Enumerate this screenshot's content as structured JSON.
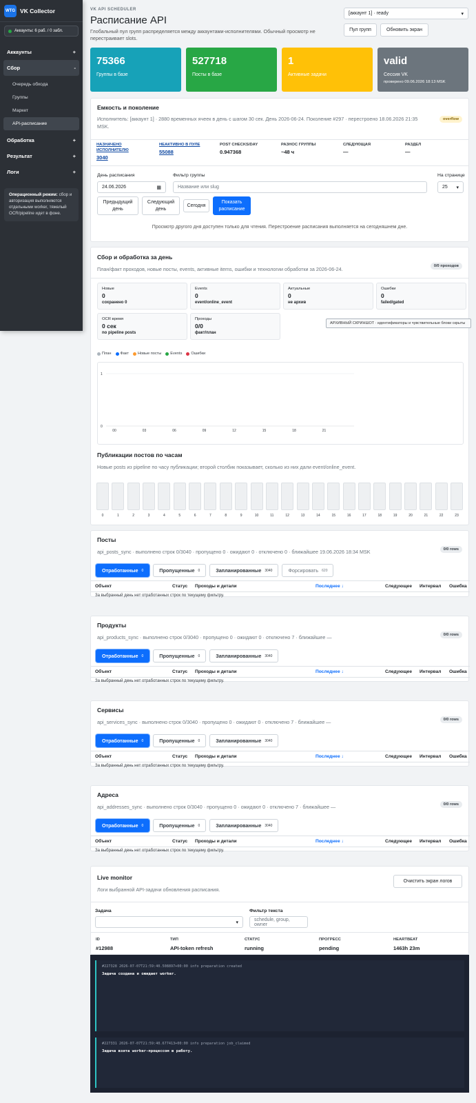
{
  "sidebar": {
    "brand_logo": "WTG",
    "brand_name": "VK Collector",
    "accounts_badge": "Аккаунты: 6 раб. / 0 забл.",
    "sections": [
      {
        "label": "Аккаунты",
        "toggle": "+"
      },
      {
        "label": "Сбор",
        "toggle": "-"
      },
      {
        "label": "Обработка",
        "toggle": "+"
      },
      {
        "label": "Результат",
        "toggle": "+"
      },
      {
        "label": "Логи",
        "toggle": "+"
      }
    ],
    "sbor_items": [
      "Очередь обхода",
      "Группы",
      "Маркет",
      "API-расписание"
    ],
    "op_note_bold": "Операционный режим:",
    "op_note_text": " сбор и авторизация выполняются отдельными worker, тяжелый OCR/pipeline идет в фоне."
  },
  "header": {
    "kicker": "VK API SCHEDULER",
    "title": "Расписание API",
    "subtitle": "Глобальный пул групп распределяется между аккаунтами-исполнителями. Обычный просмотр не перестраивает slots.",
    "account_select": "[аккаунт 1] · ready",
    "pool_button": "Пул групп",
    "refresh_button": "Обновить экран"
  },
  "stats": [
    {
      "value": "75366",
      "label": "Группы в базе",
      "color": "#17a2b8"
    },
    {
      "value": "527718",
      "label": "Посты в базе",
      "color": "#28a745"
    },
    {
      "value": "1",
      "label": "Активные задачи",
      "color": "#ffc107"
    },
    {
      "value": "valid",
      "label": "Сессия VK",
      "label2": "проверено 09.06.2026 18:13 MSK",
      "color": "#6c757d"
    }
  ],
  "capacity": {
    "title": "Емкость и поколение",
    "badge": "overflow",
    "desc": "Исполнитель: [аккаунт 1] · 2880 временных ячеек в день с шагом 30 сек. День 2026-06-24. Поколение #297 · перестроено 18.06.2026 21:35 MSK.",
    "metrics": [
      {
        "label": "НАЗНАЧЕНО ИСПОЛНИТЕЛЮ",
        "value": "3040",
        "link": true
      },
      {
        "label": "НЕАКТИВНО В ПУЛЕ",
        "value": "55088",
        "link": true
      },
      {
        "label": "POST CHECKS/DAY",
        "value": "0.947368",
        "link": false
      },
      {
        "label": "РАЗНОС ГРУППЫ",
        "value": "~48 ч",
        "link": false
      },
      {
        "label": "СЛЕДУЮЩАЯ",
        "value": "—",
        "link": false
      },
      {
        "label": "РАЗДЕЛ",
        "value": "—",
        "link": false
      }
    ],
    "day_label": "День расписания",
    "day_value": "24.06.2026",
    "filter_label": "Фильтр группы",
    "filter_placeholder": "Название или slug",
    "per_page_label": "На странице",
    "per_page_value": "25",
    "btn_prev": "Предыдущий день",
    "btn_next": "Следующий день",
    "btn_today": "Сегодня",
    "btn_show": "Показать расписание",
    "readonly_note": "Просмотр другого дня доступен только для чтения. Перестроение расписания выполняется на сегодняшнем дне."
  },
  "daily": {
    "title": "Сбор и обработка за день",
    "badge": "0/0 проходов",
    "desc": "План/факт проходов, новые посты, events, активные items, ошибки и технологии обработки за 2026-06-24.",
    "minis": [
      {
        "a": "Новые",
        "b": "0",
        "c": "сохранено 0"
      },
      {
        "a": "Events",
        "b": "0",
        "c": "event/online_event"
      },
      {
        "a": "Актуальные",
        "b": "0",
        "c": "не архив"
      },
      {
        "a": "Ошибки",
        "b": "0",
        "c": "failed/gated"
      },
      {
        "a": "OCR время",
        "b": "0 сек",
        "c": "no pipeline posts"
      },
      {
        "a": "Проходы",
        "b": "0/0",
        "c": "факт/план"
      }
    ],
    "tooltip": "АРХИВНЫЙ СКРИНШОТ · идентификаторы и чувствительные блоки скрыты",
    "legend": [
      {
        "name": "План",
        "color": "#adb5bd"
      },
      {
        "name": "Факт",
        "color": "#0d6efd"
      },
      {
        "name": "Новые посты",
        "color": "#fd9a2f"
      },
      {
        "name": "Events",
        "color": "#28a745"
      },
      {
        "name": "Ошибки",
        "color": "#dc3545"
      }
    ],
    "hourly_title": "Публикации постов по часам",
    "hourly_desc": "Новые posts из pipeline по часу публикации; второй столбик показывает, сколько из них дали event/online_event."
  },
  "chart_data": [
    {
      "type": "line",
      "x": [
        "00",
        "03",
        "06",
        "09",
        "12",
        "15",
        "18",
        "21"
      ],
      "series": [],
      "y_ticks": [
        "0",
        "1"
      ],
      "ylim": [
        0,
        1
      ],
      "grid": true,
      "legend_position": "top-left"
    },
    {
      "type": "bar",
      "categories": [
        "0",
        "1",
        "2",
        "3",
        "4",
        "5",
        "6",
        "7",
        "8",
        "9",
        "10",
        "11",
        "12",
        "13",
        "14",
        "15",
        "16",
        "17",
        "18",
        "19",
        "20",
        "21",
        "22",
        "23"
      ],
      "values": [
        0,
        0,
        0,
        0,
        0,
        0,
        0,
        0,
        0,
        0,
        0,
        0,
        0,
        0,
        0,
        0,
        0,
        0,
        0,
        0,
        0,
        0,
        0,
        0
      ]
    }
  ],
  "sections": [
    {
      "title": "Посты",
      "badge": "0/0 rows",
      "desc": "api_posts_sync · выполнено строк 0/3040 · пропущено 0 · ожидают 0 · отключено 0 · ближайшее 19.06.2026 18:34 MSK",
      "tabs": [
        {
          "label": "Отработанные",
          "count": "0"
        },
        {
          "label": "Пропущенные",
          "count": "0"
        },
        {
          "label": "Запланированные",
          "count": "3040"
        },
        {
          "label": "Форсировать",
          "count": "620"
        }
      ]
    },
    {
      "title": "Продукты",
      "badge": "0/0 rows",
      "desc": "api_products_sync · выполнено строк 0/3040 · пропущено 0 · ожидают 0 · отключено 7 · ближайшее —",
      "tabs": [
        {
          "label": "Отработанные",
          "count": "0"
        },
        {
          "label": "Пропущенные",
          "count": "0"
        },
        {
          "label": "Запланированные",
          "count": "3040"
        }
      ]
    },
    {
      "title": "Сервисы",
      "badge": "0/0 rows",
      "desc": "api_services_sync · выполнено строк 0/3040 · пропущено 0 · ожидают 0 · отключено 7 · ближайшее —",
      "tabs": [
        {
          "label": "Отработанные",
          "count": "0"
        },
        {
          "label": "Пропущенные",
          "count": "0"
        },
        {
          "label": "Запланированные",
          "count": "3040"
        }
      ]
    },
    {
      "title": "Адреса",
      "badge": "0/0 rows",
      "desc": "api_addresses_sync · выполнено строк 0/3040 · пропущено 0 · ожидают 0 · отключено 7 · ближайшее —",
      "tabs": [
        {
          "label": "Отработанные",
          "count": "0"
        },
        {
          "label": "Пропущенные",
          "count": "0"
        },
        {
          "label": "Запланированные",
          "count": "3040"
        }
      ]
    }
  ],
  "table": {
    "columns": [
      "Объект",
      "Статус",
      "Проходы и детали",
      "Последнее ↓",
      "Следующее",
      "Интервал",
      "Ошибка"
    ],
    "empty": "За выбранный день нет отработанных строк по текущему фильтру."
  },
  "monitor": {
    "title": "Live monitor",
    "desc": "Логи выбранной API-задачи обновления расписания.",
    "clear_button": "Очистить экран логов",
    "task_label": "Задача",
    "text_filter_label": "Фильтр текста",
    "text_filter_placeholder": "schedule, group, owner",
    "fields": [
      {
        "label": "ID",
        "value": "#12988"
      },
      {
        "label": "ТИП",
        "value": "API-token refresh"
      },
      {
        "label": "СТАТУС",
        "value": "running"
      },
      {
        "label": "ПРОГРЕСС",
        "value": "pending"
      },
      {
        "label": "HEARTBEAT",
        "value": "1463h 23m"
      }
    ],
    "logs": [
      {
        "meta": "#227328  2026-07-07T21:59:40.508897+00:00  info  preparation  created",
        "msg": "Задача создана и ожидает worker."
      },
      {
        "meta": "#227331  2026-07-07T21:59:40.677413+00:00  info  preparation  job_claimed",
        "msg": "Задача взята worker-процессом в работу."
      }
    ]
  }
}
